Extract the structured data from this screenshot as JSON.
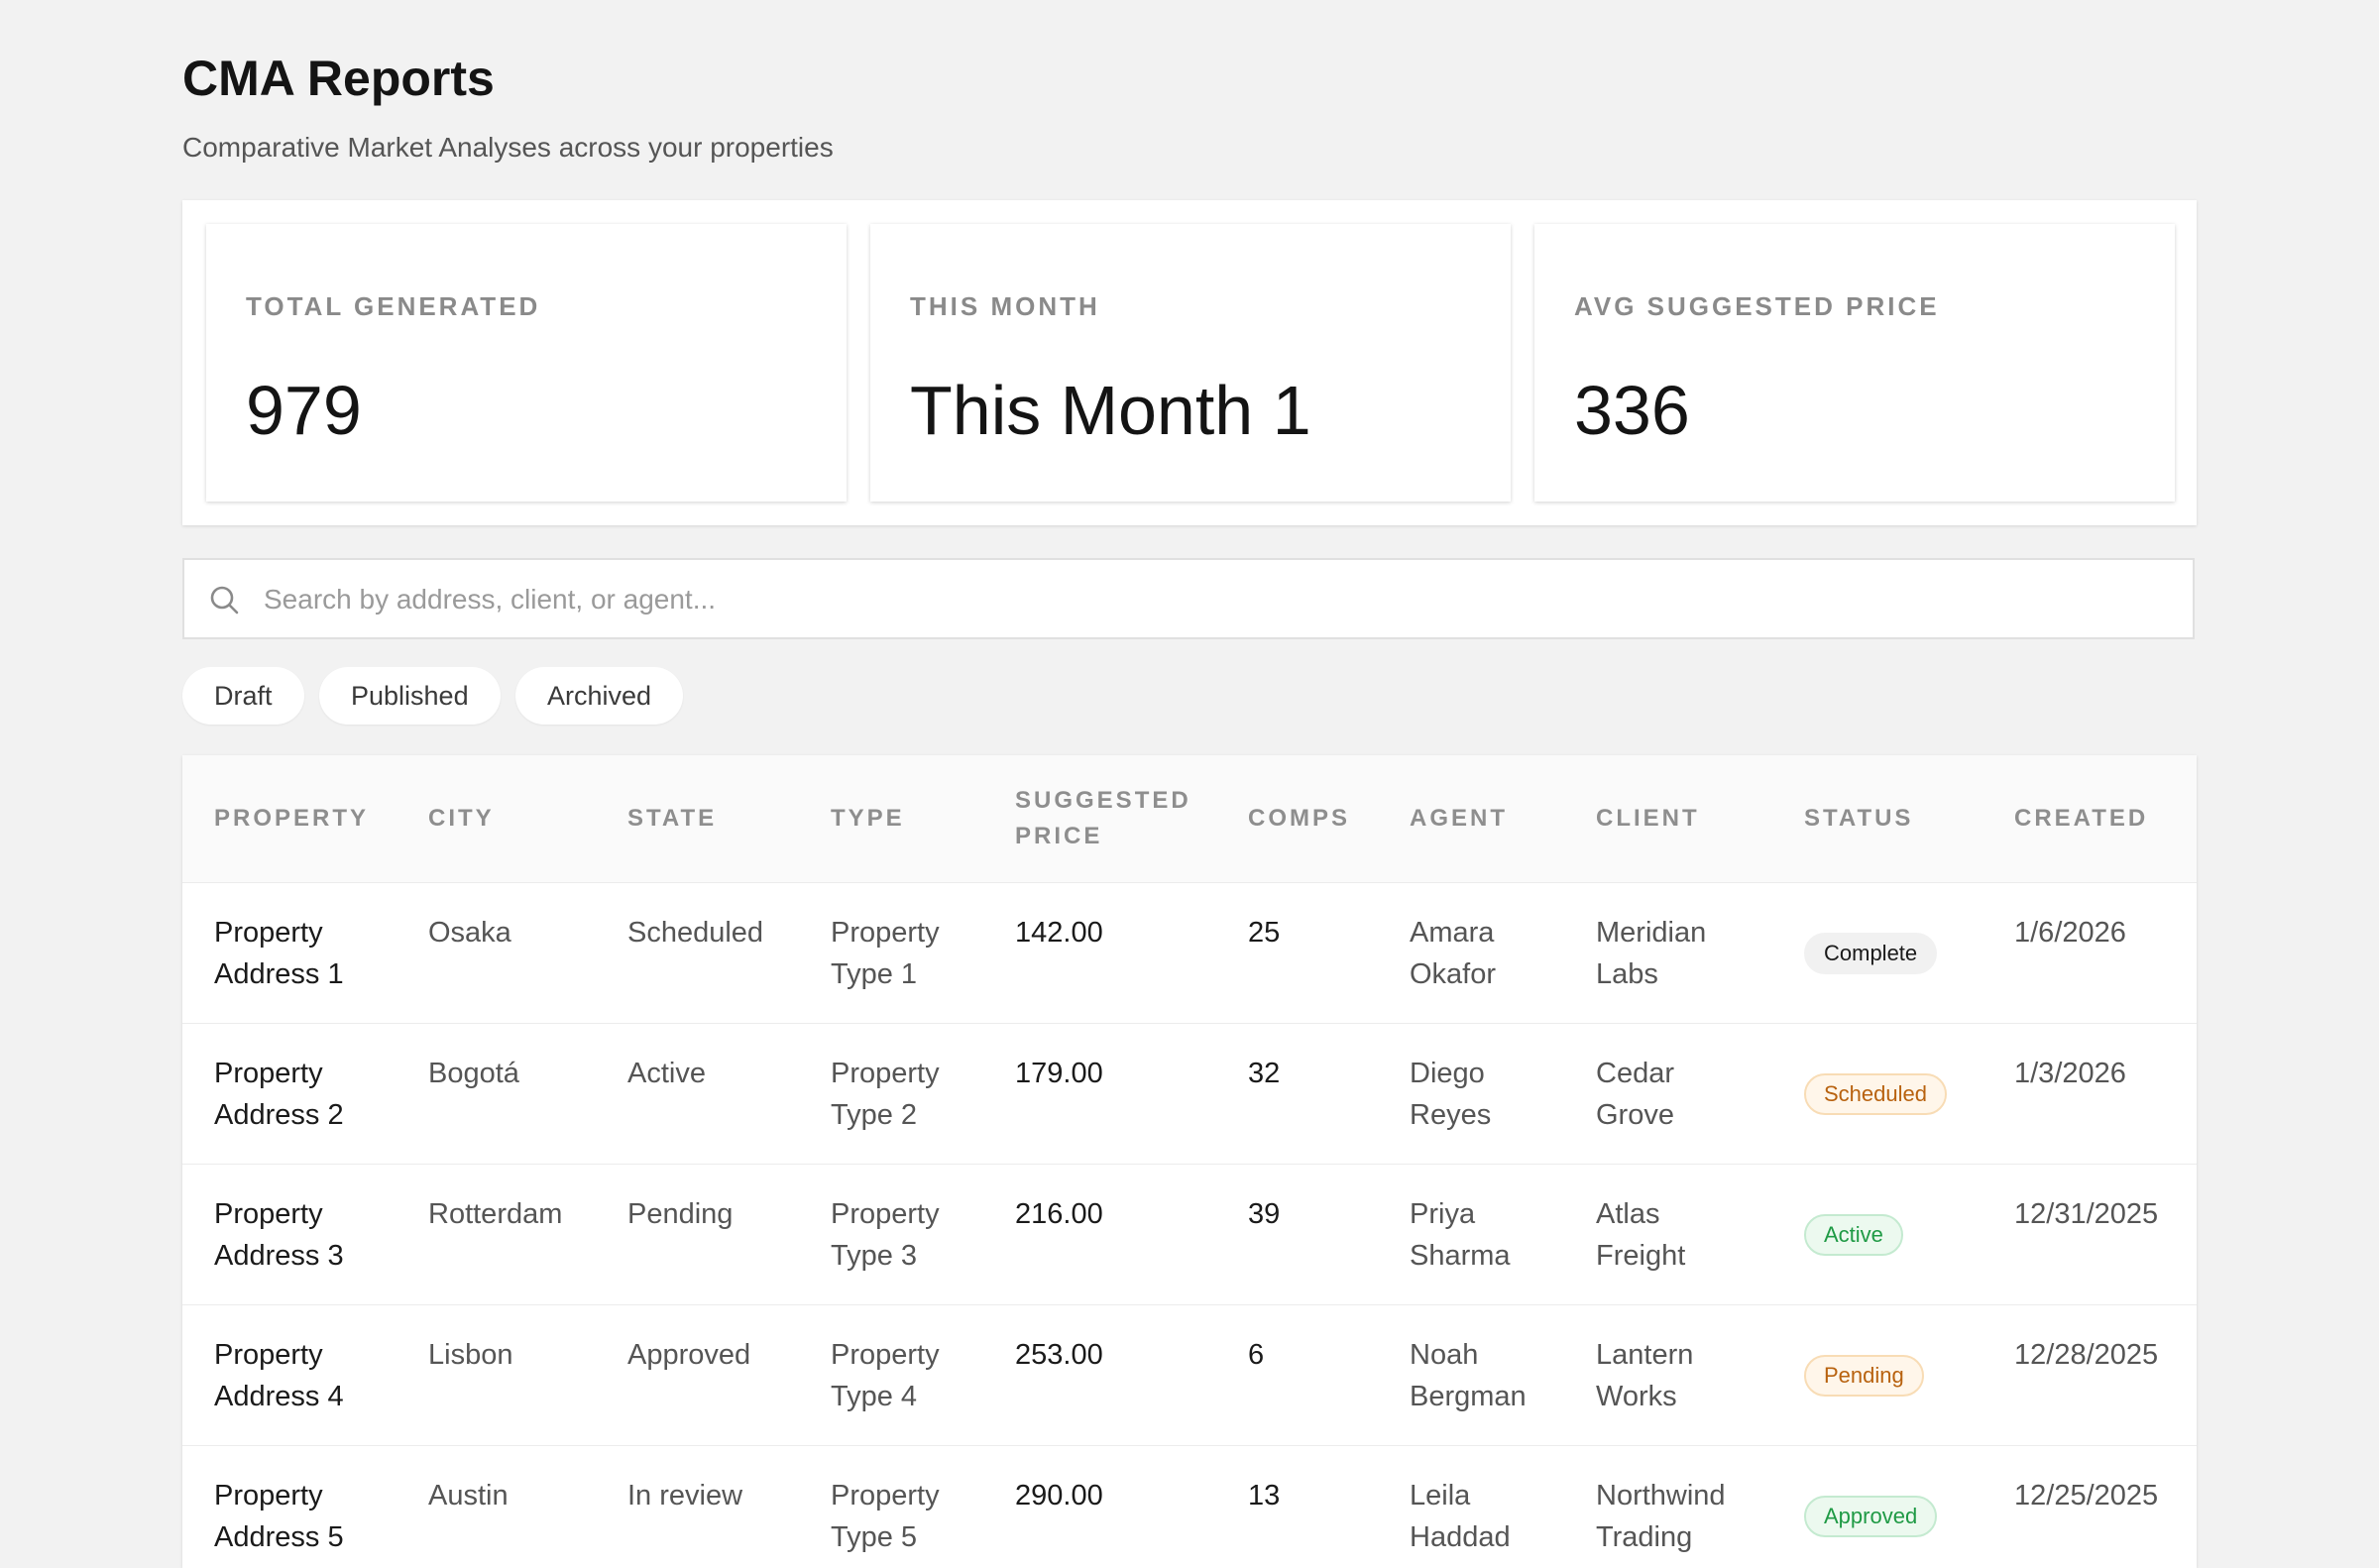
{
  "header": {
    "title": "CMA Reports",
    "subtitle": "Comparative Market Analyses across your properties"
  },
  "stats": [
    {
      "label": "TOTAL GENERATED",
      "value": "979"
    },
    {
      "label": "THIS MONTH",
      "value": "This Month 1"
    },
    {
      "label": "AVG SUGGESTED PRICE",
      "value": "336"
    }
  ],
  "search": {
    "placeholder": "Search by address, client, or agent...",
    "value": "",
    "icon": "search-icon"
  },
  "filters": [
    "Draft",
    "Published",
    "Archived"
  ],
  "table": {
    "columns": [
      "PROPERTY",
      "CITY",
      "STATE",
      "TYPE",
      "SUGGESTED PRICE",
      "COMPS",
      "AGENT",
      "CLIENT",
      "STATUS",
      "CREATED"
    ],
    "rows": [
      {
        "property": "Property Address 1",
        "city": "Osaka",
        "state": "Scheduled",
        "type": "Property Type 1",
        "price": "142.00",
        "comps": "25",
        "agent": "Amara Okafor",
        "client": "Meridian Labs",
        "status": "Complete",
        "created": "1/6/2026"
      },
      {
        "property": "Property Address 2",
        "city": "Bogotá",
        "state": "Active",
        "type": "Property Type 2",
        "price": "179.00",
        "comps": "32",
        "agent": "Diego Reyes",
        "client": "Cedar Grove",
        "status": "Scheduled",
        "created": "1/3/2026"
      },
      {
        "property": "Property Address 3",
        "city": "Rotterdam",
        "state": "Pending",
        "type": "Property Type 3",
        "price": "216.00",
        "comps": "39",
        "agent": "Priya Sharma",
        "client": "Atlas Freight",
        "status": "Active",
        "created": "12/31/2025"
      },
      {
        "property": "Property Address 4",
        "city": "Lisbon",
        "state": "Approved",
        "type": "Property Type 4",
        "price": "253.00",
        "comps": "6",
        "agent": "Noah Bergman",
        "client": "Lantern Works",
        "status": "Pending",
        "created": "12/28/2025"
      },
      {
        "property": "Property Address 5",
        "city": "Austin",
        "state": "In review",
        "type": "Property Type 5",
        "price": "290.00",
        "comps": "13",
        "agent": "Leila Haddad",
        "client": "Northwind Trading",
        "status": "Approved",
        "created": "12/25/2025"
      }
    ]
  },
  "status_colors": {
    "Complete": {
      "bg": "#f1f1f1",
      "border": "#f1f1f1",
      "text": "#1a1a1a"
    },
    "Scheduled": {
      "bg": "#fff6ea",
      "border": "#f8dcb5",
      "text": "#b8620f"
    },
    "Active": {
      "bg": "#ecf9ef",
      "border": "#c4ead0",
      "text": "#1f9a45"
    },
    "Pending": {
      "bg": "#fff6ea",
      "border": "#f8dcb5",
      "text": "#b8620f"
    },
    "Approved": {
      "bg": "#ecf9ef",
      "border": "#c4ead0",
      "text": "#1f9a45"
    }
  }
}
